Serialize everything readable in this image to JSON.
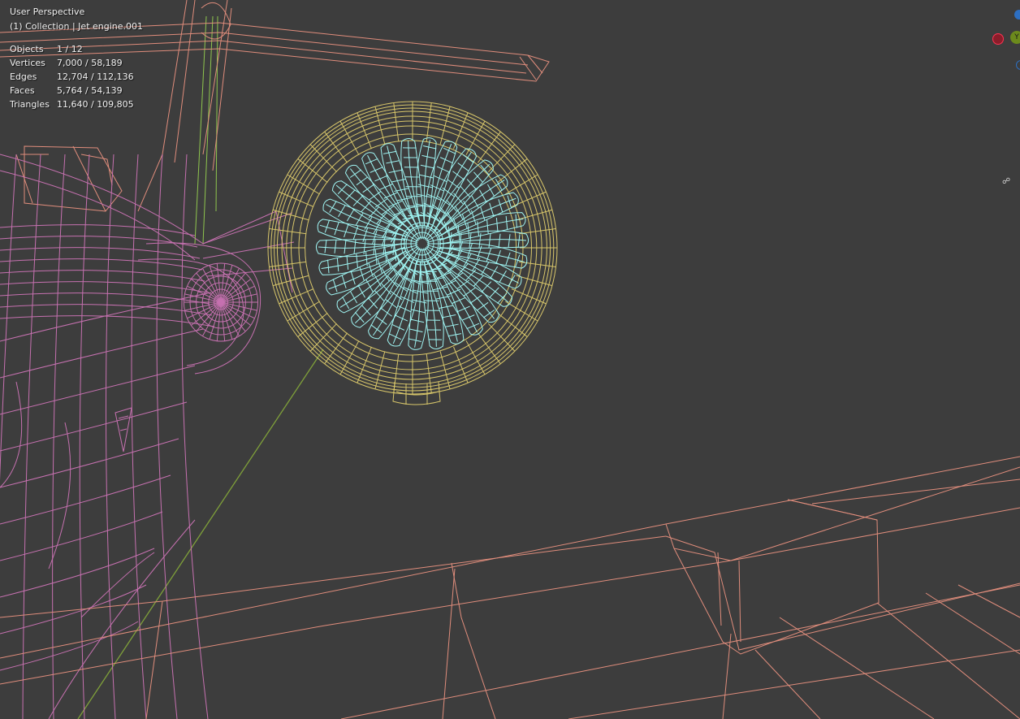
{
  "viewport": {
    "title": "User Perspective",
    "collection": "(1) Collection | Jet engine.001"
  },
  "stats": [
    {
      "label": "Objects",
      "value": "1 / 12"
    },
    {
      "label": "Vertices",
      "value": "7,000 / 58,189"
    },
    {
      "label": "Edges",
      "value": "12,704 / 112,136"
    },
    {
      "label": "Faces",
      "value": "5,764 / 54,139"
    },
    {
      "label": "Triangles",
      "value": "11,640 / 109,805"
    }
  ],
  "gizmo": {
    "y_label": "Y",
    "icons": [
      "x-axis-icon",
      "y-axis-icon",
      "z-axis-icon"
    ]
  },
  "colors": {
    "background": "#3d3d3d",
    "selected_object": "#9ff4f2",
    "engine_nacelle": "#d8c66a",
    "fuselage": "#c671b0",
    "wing": "#e08d7c",
    "strut": "#8fc64e",
    "x_axis": "#ff3352",
    "y_axis": "#8bdc00",
    "z_axis": "#2890ff"
  }
}
